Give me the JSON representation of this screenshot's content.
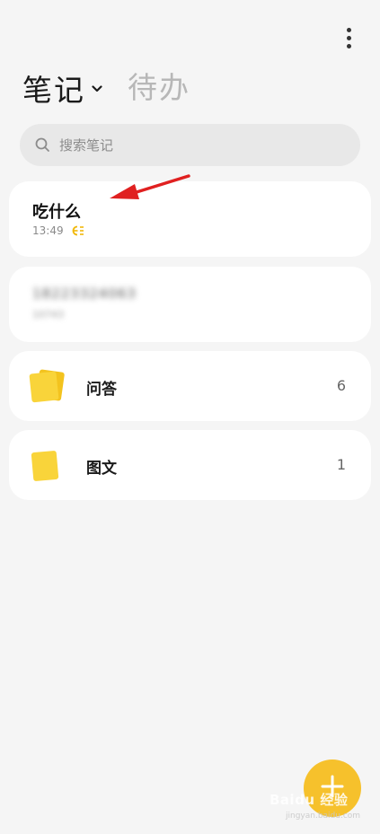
{
  "header": {
    "tab_notes": "笔记",
    "tab_todo": "待办",
    "more_icon": "more-vertical-icon"
  },
  "search": {
    "placeholder": "搜索笔记",
    "value": ""
  },
  "notes": [
    {
      "title": "吃什么",
      "time": "13:49",
      "type_icon": "list-icon"
    },
    {
      "title": "18223324063",
      "subtitle": "10743"
    }
  ],
  "folders": [
    {
      "name": "问答",
      "count": "6"
    },
    {
      "name": "图文",
      "count": "1"
    }
  ],
  "fab": {
    "icon": "plus-icon"
  },
  "watermark": {
    "text": "Baidu 经验",
    "url": "jingyan.baidu.com"
  },
  "colors": {
    "accent": "#f6c12c",
    "folder_yellow": "#f9d43a",
    "annotation_arrow": "#e02020",
    "background": "#f5f5f5",
    "card": "#ffffff"
  }
}
